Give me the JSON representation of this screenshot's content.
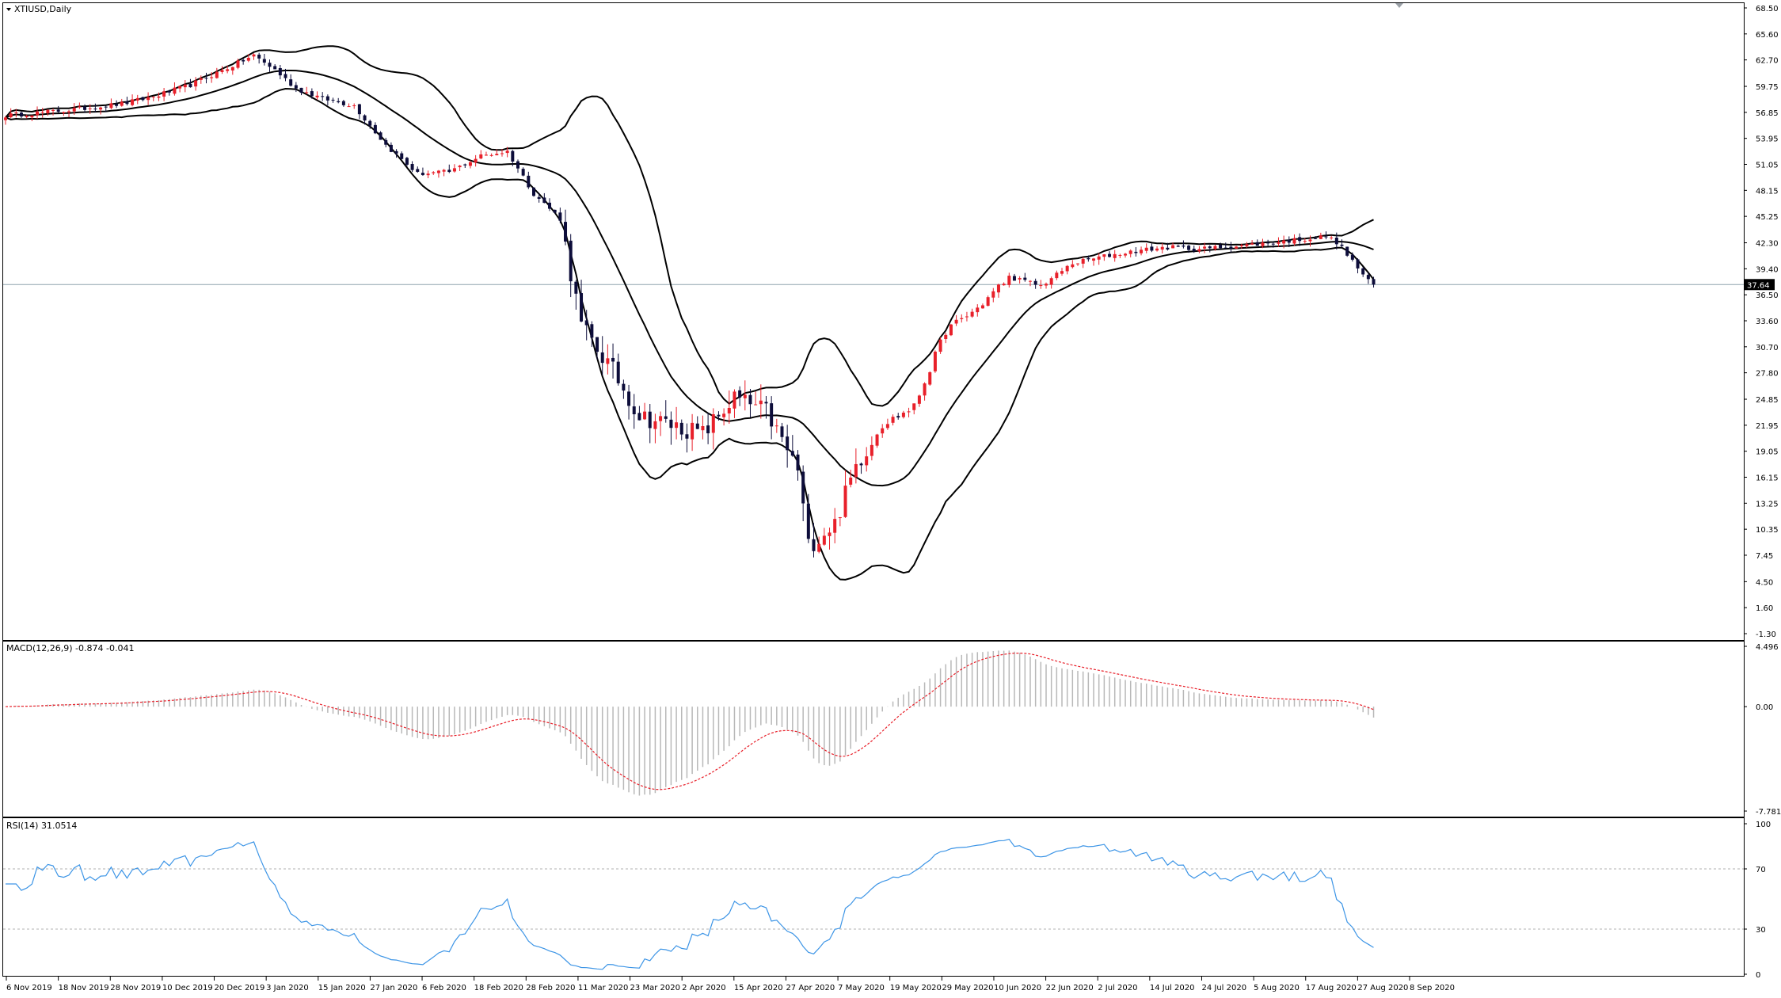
{
  "chart_data": {
    "type": "candlestick",
    "symbol_title": "XTIUSD,Daily",
    "price_panel": {
      "ylim": [
        -1.3,
        68.5
      ],
      "y_ticks": [
        "68.50",
        "65.60",
        "62.70",
        "59.75",
        "56.85",
        "53.95",
        "51.05",
        "48.15",
        "45.25",
        "42.30",
        "39.40",
        "36.50",
        "33.60",
        "30.70",
        "27.80",
        "24.85",
        "21.95",
        "19.05",
        "16.15",
        "13.25",
        "10.35",
        "7.45",
        "4.50",
        "1.60",
        "-1.30"
      ],
      "current_price": "37.64",
      "up_color": "#e8202a",
      "down_color": "#0d0d3a",
      "band_color": "#000000",
      "price_line_color": "#8fa3ad",
      "close_anchors": [
        [
          0,
          56.5
        ],
        [
          12,
          57.1
        ],
        [
          22,
          57.8
        ],
        [
          28,
          58.6
        ],
        [
          35,
          59.9
        ],
        [
          42,
          61.8
        ],
        [
          47,
          63.2
        ],
        [
          51,
          61.6
        ],
        [
          55,
          59.5
        ],
        [
          60,
          58.4
        ],
        [
          66,
          57.6
        ],
        [
          72,
          53.2
        ],
        [
          78,
          50.0
        ],
        [
          84,
          50.2
        ],
        [
          90,
          52.0
        ],
        [
          95,
          52.5
        ],
        [
          100,
          47.8
        ],
        [
          105,
          45.0
        ],
        [
          109,
          33.0
        ],
        [
          115,
          28.0
        ],
        [
          120,
          23.0
        ],
        [
          126,
          22.0
        ],
        [
          132,
          21.0
        ],
        [
          138,
          25.0
        ],
        [
          144,
          23.5
        ],
        [
          150,
          17.0
        ],
        [
          152,
          8.5
        ],
        [
          157,
          11.0
        ],
        [
          161,
          17.5
        ],
        [
          166,
          22.0
        ],
        [
          172,
          24.0
        ],
        [
          178,
          32.5
        ],
        [
          184,
          35.0
        ],
        [
          190,
          38.5
        ],
        [
          196,
          37.5
        ],
        [
          202,
          40.0
        ],
        [
          208,
          40.8
        ],
        [
          214,
          41.4
        ],
        [
          220,
          41.8
        ],
        [
          226,
          41.6
        ],
        [
          232,
          41.9
        ],
        [
          238,
          42.2
        ],
        [
          244,
          42.6
        ],
        [
          250,
          43.0
        ],
        [
          252,
          42.4
        ],
        [
          254,
          41.0
        ],
        [
          256,
          39.5
        ],
        [
          258,
          38.0
        ],
        [
          259,
          37.64
        ]
      ]
    },
    "macd_panel": {
      "title": "MACD(12,26,9) -0.874 -0.041",
      "ylim": [
        -7.781,
        4.496
      ],
      "y_ticks": [
        "4.496",
        "0.00",
        "-7.781"
      ],
      "hist_color": "#b8b8b8",
      "signal_color": "#e8202a"
    },
    "rsi_panel": {
      "title": "RSI(14) 31.0514",
      "ylim": [
        0,
        100
      ],
      "y_ticks": [
        "100",
        "70",
        "30",
        "0"
      ],
      "levels": [
        70,
        30
      ],
      "line_color": "#3d95e6"
    },
    "x_tick_labels": [
      "6 Nov 2019",
      "18 Nov 2019",
      "28 Nov 2019",
      "10 Dec 2019",
      "20 Dec 2019",
      "3 Jan 2020",
      "15 Jan 2020",
      "27 Jan 2020",
      "6 Feb 2020",
      "18 Feb 2020",
      "28 Feb 2020",
      "11 Mar 2020",
      "23 Mar 2020",
      "2 Apr 2020",
      "15 Apr 2020",
      "27 Apr 2020",
      "7 May 2020",
      "19 May 2020",
      "29 May 2020",
      "10 Jun 2020",
      "22 Jun 2020",
      "2 Jul 2020",
      "14 Jul 2020",
      "24 Jul 2020",
      "5 Aug 2020",
      "17 Aug 2020",
      "27 Aug 2020",
      "8 Sep 2020"
    ]
  }
}
